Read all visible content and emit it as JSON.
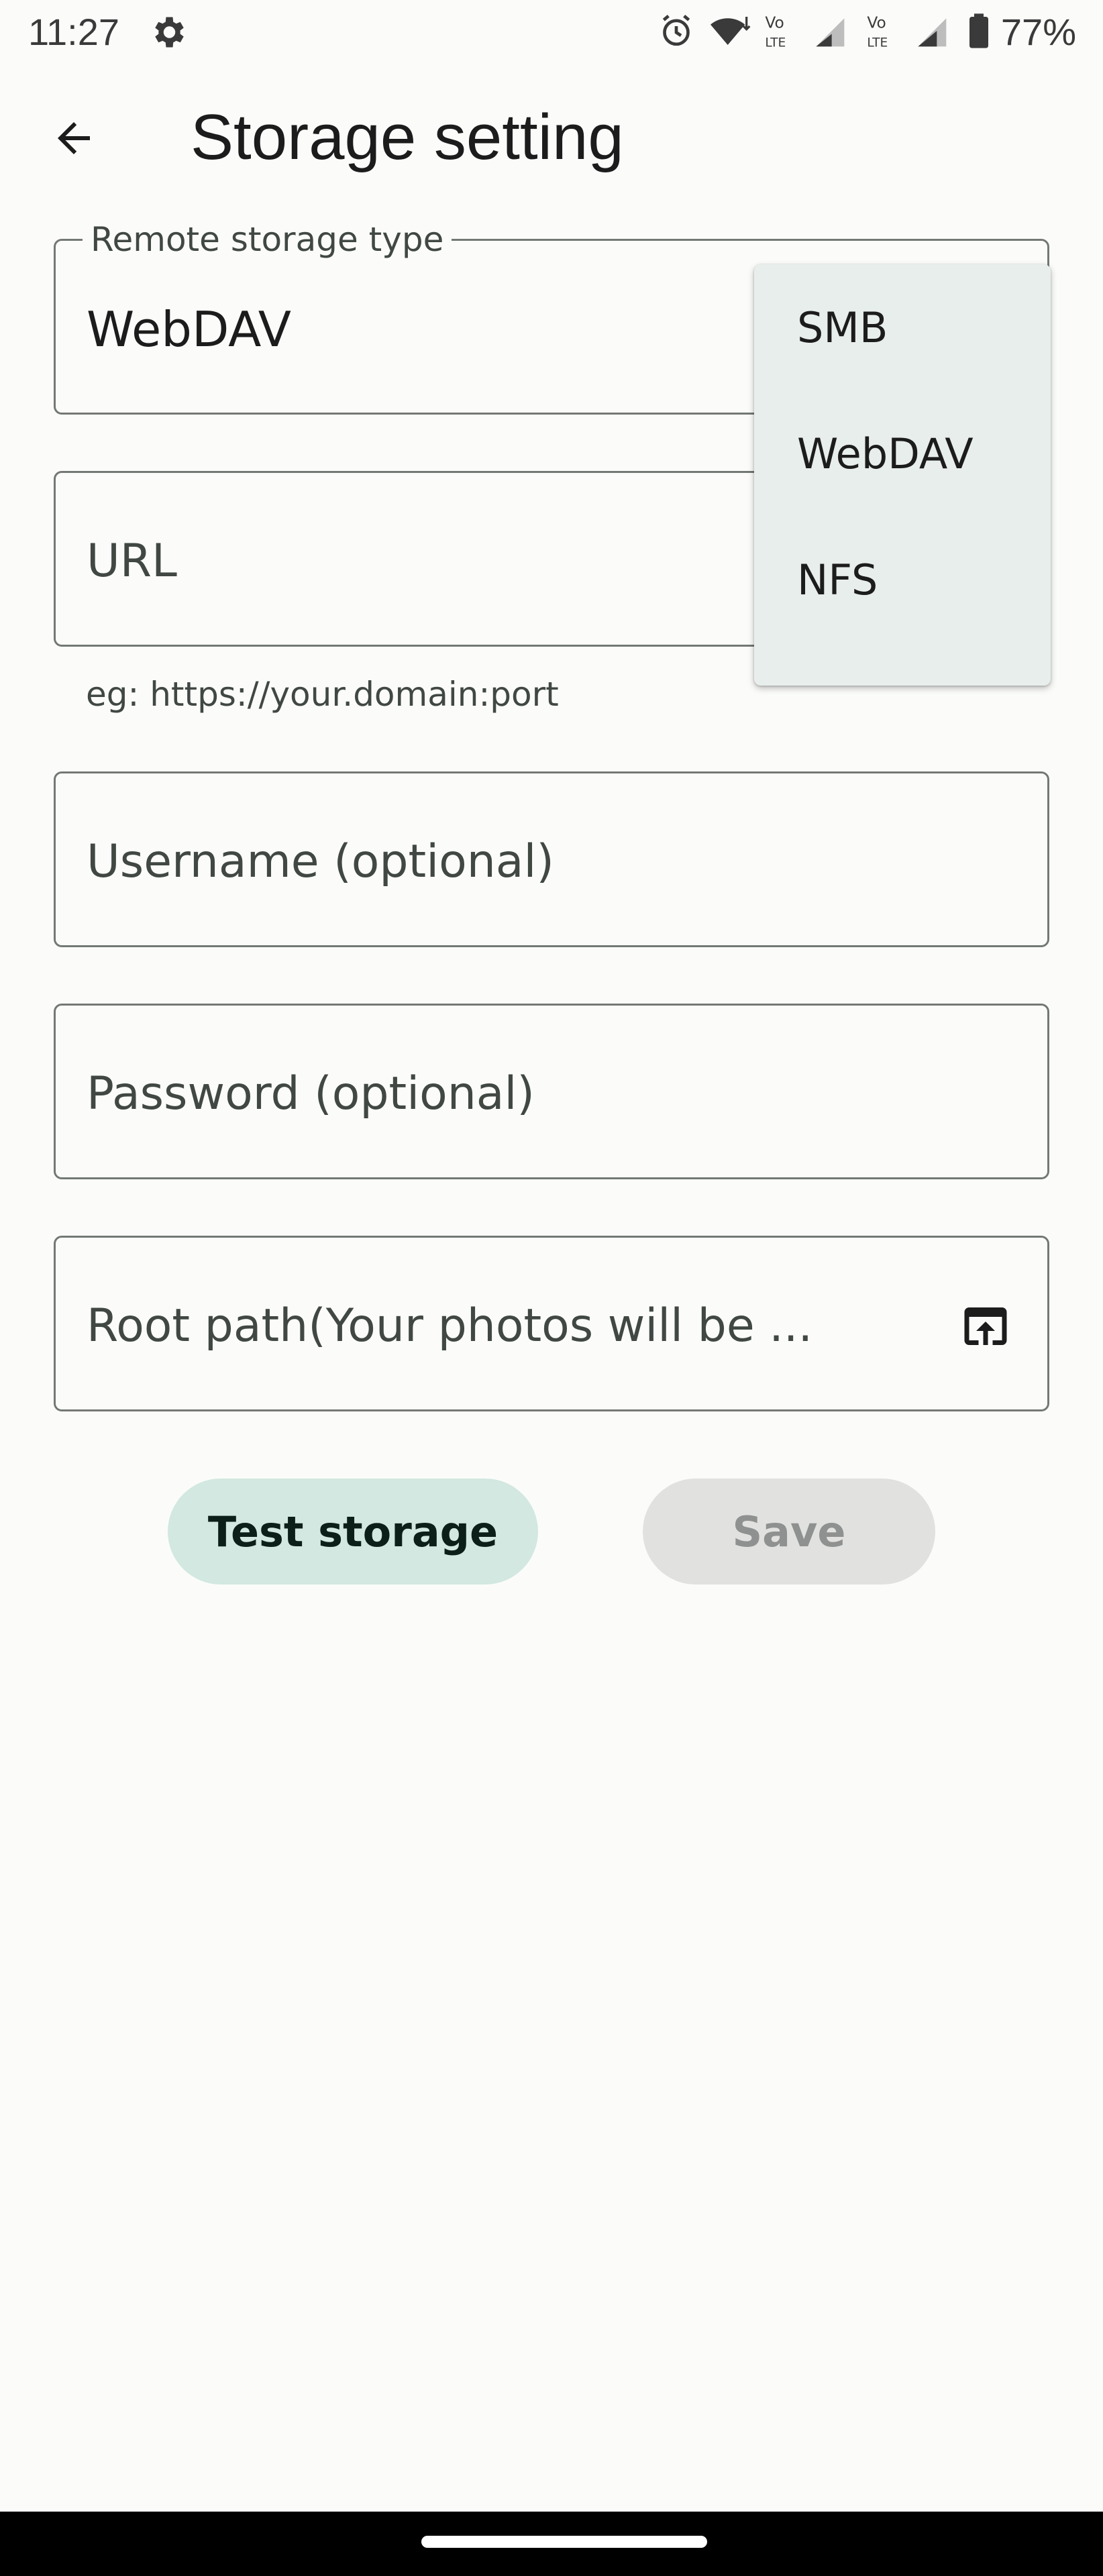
{
  "status_bar": {
    "time": "11:27",
    "battery": "77%",
    "icons": [
      "settings-gear-icon",
      "alarm-icon",
      "wifi-icon",
      "volte-icon",
      "signal-icon",
      "volte-icon",
      "signal-icon",
      "battery-icon"
    ]
  },
  "app_bar": {
    "title": "Storage setting",
    "back_icon": "arrow-back-icon"
  },
  "form": {
    "storage_type": {
      "label": "Remote storage type",
      "value": "WebDAV"
    },
    "url": {
      "placeholder": "URL",
      "supporting_text": "eg: https://your.domain:port"
    },
    "username": {
      "placeholder": "Username (optional)"
    },
    "password": {
      "placeholder": "Password (optional)"
    },
    "root_path": {
      "placeholder": "Root path(Your photos will be ...",
      "trailing_icon": "folder-open-icon"
    }
  },
  "buttons": {
    "test_storage": "Test storage",
    "save": "Save"
  },
  "dropdown": {
    "options": [
      "SMB",
      "WebDAV",
      "NFS"
    ]
  },
  "colors": {
    "background": "#fbfcfa",
    "tonal_button": "#d2e8e0",
    "disabled_button": "#e1e2e0",
    "menu_surface": "#e8eeeb",
    "outline": "#737873"
  }
}
